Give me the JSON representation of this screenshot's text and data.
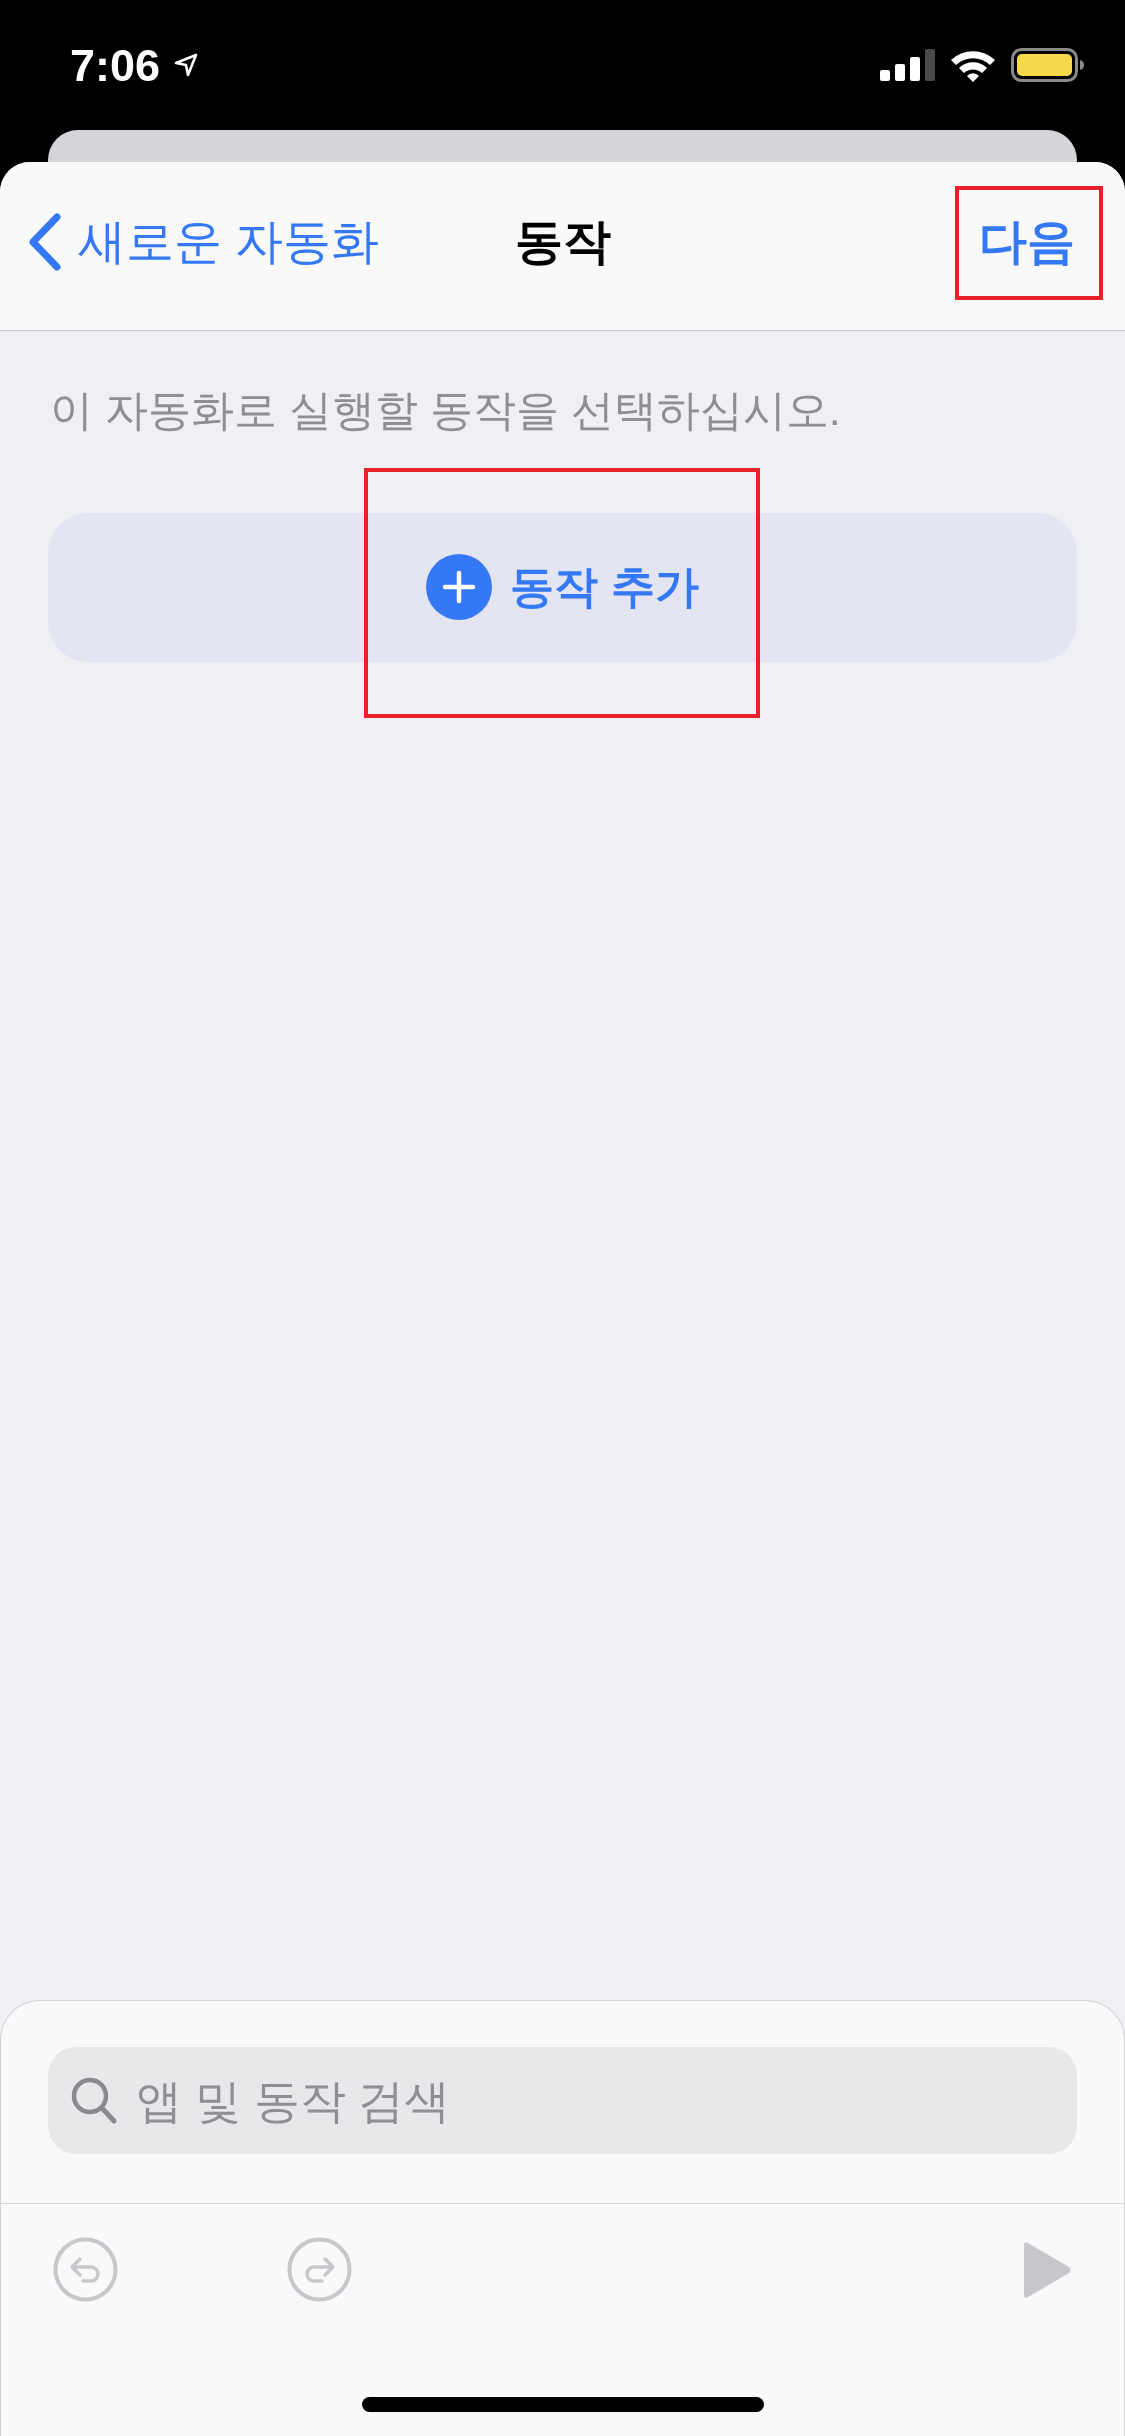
{
  "status_bar": {
    "time": "7:06"
  },
  "nav_bar": {
    "back_label": "새로운 자동화",
    "title": "동작",
    "next_label": "다음",
    "next_highlighted": true
  },
  "instruction": "이 자동화로 실행할 동작을 선택하십시오.",
  "add_action": {
    "label": "동작 추가",
    "highlighted": true
  },
  "search": {
    "placeholder": "앱 및 동작 검색"
  },
  "toolbar": {
    "undo_disabled": true,
    "redo_disabled": true,
    "run_disabled": true
  }
}
